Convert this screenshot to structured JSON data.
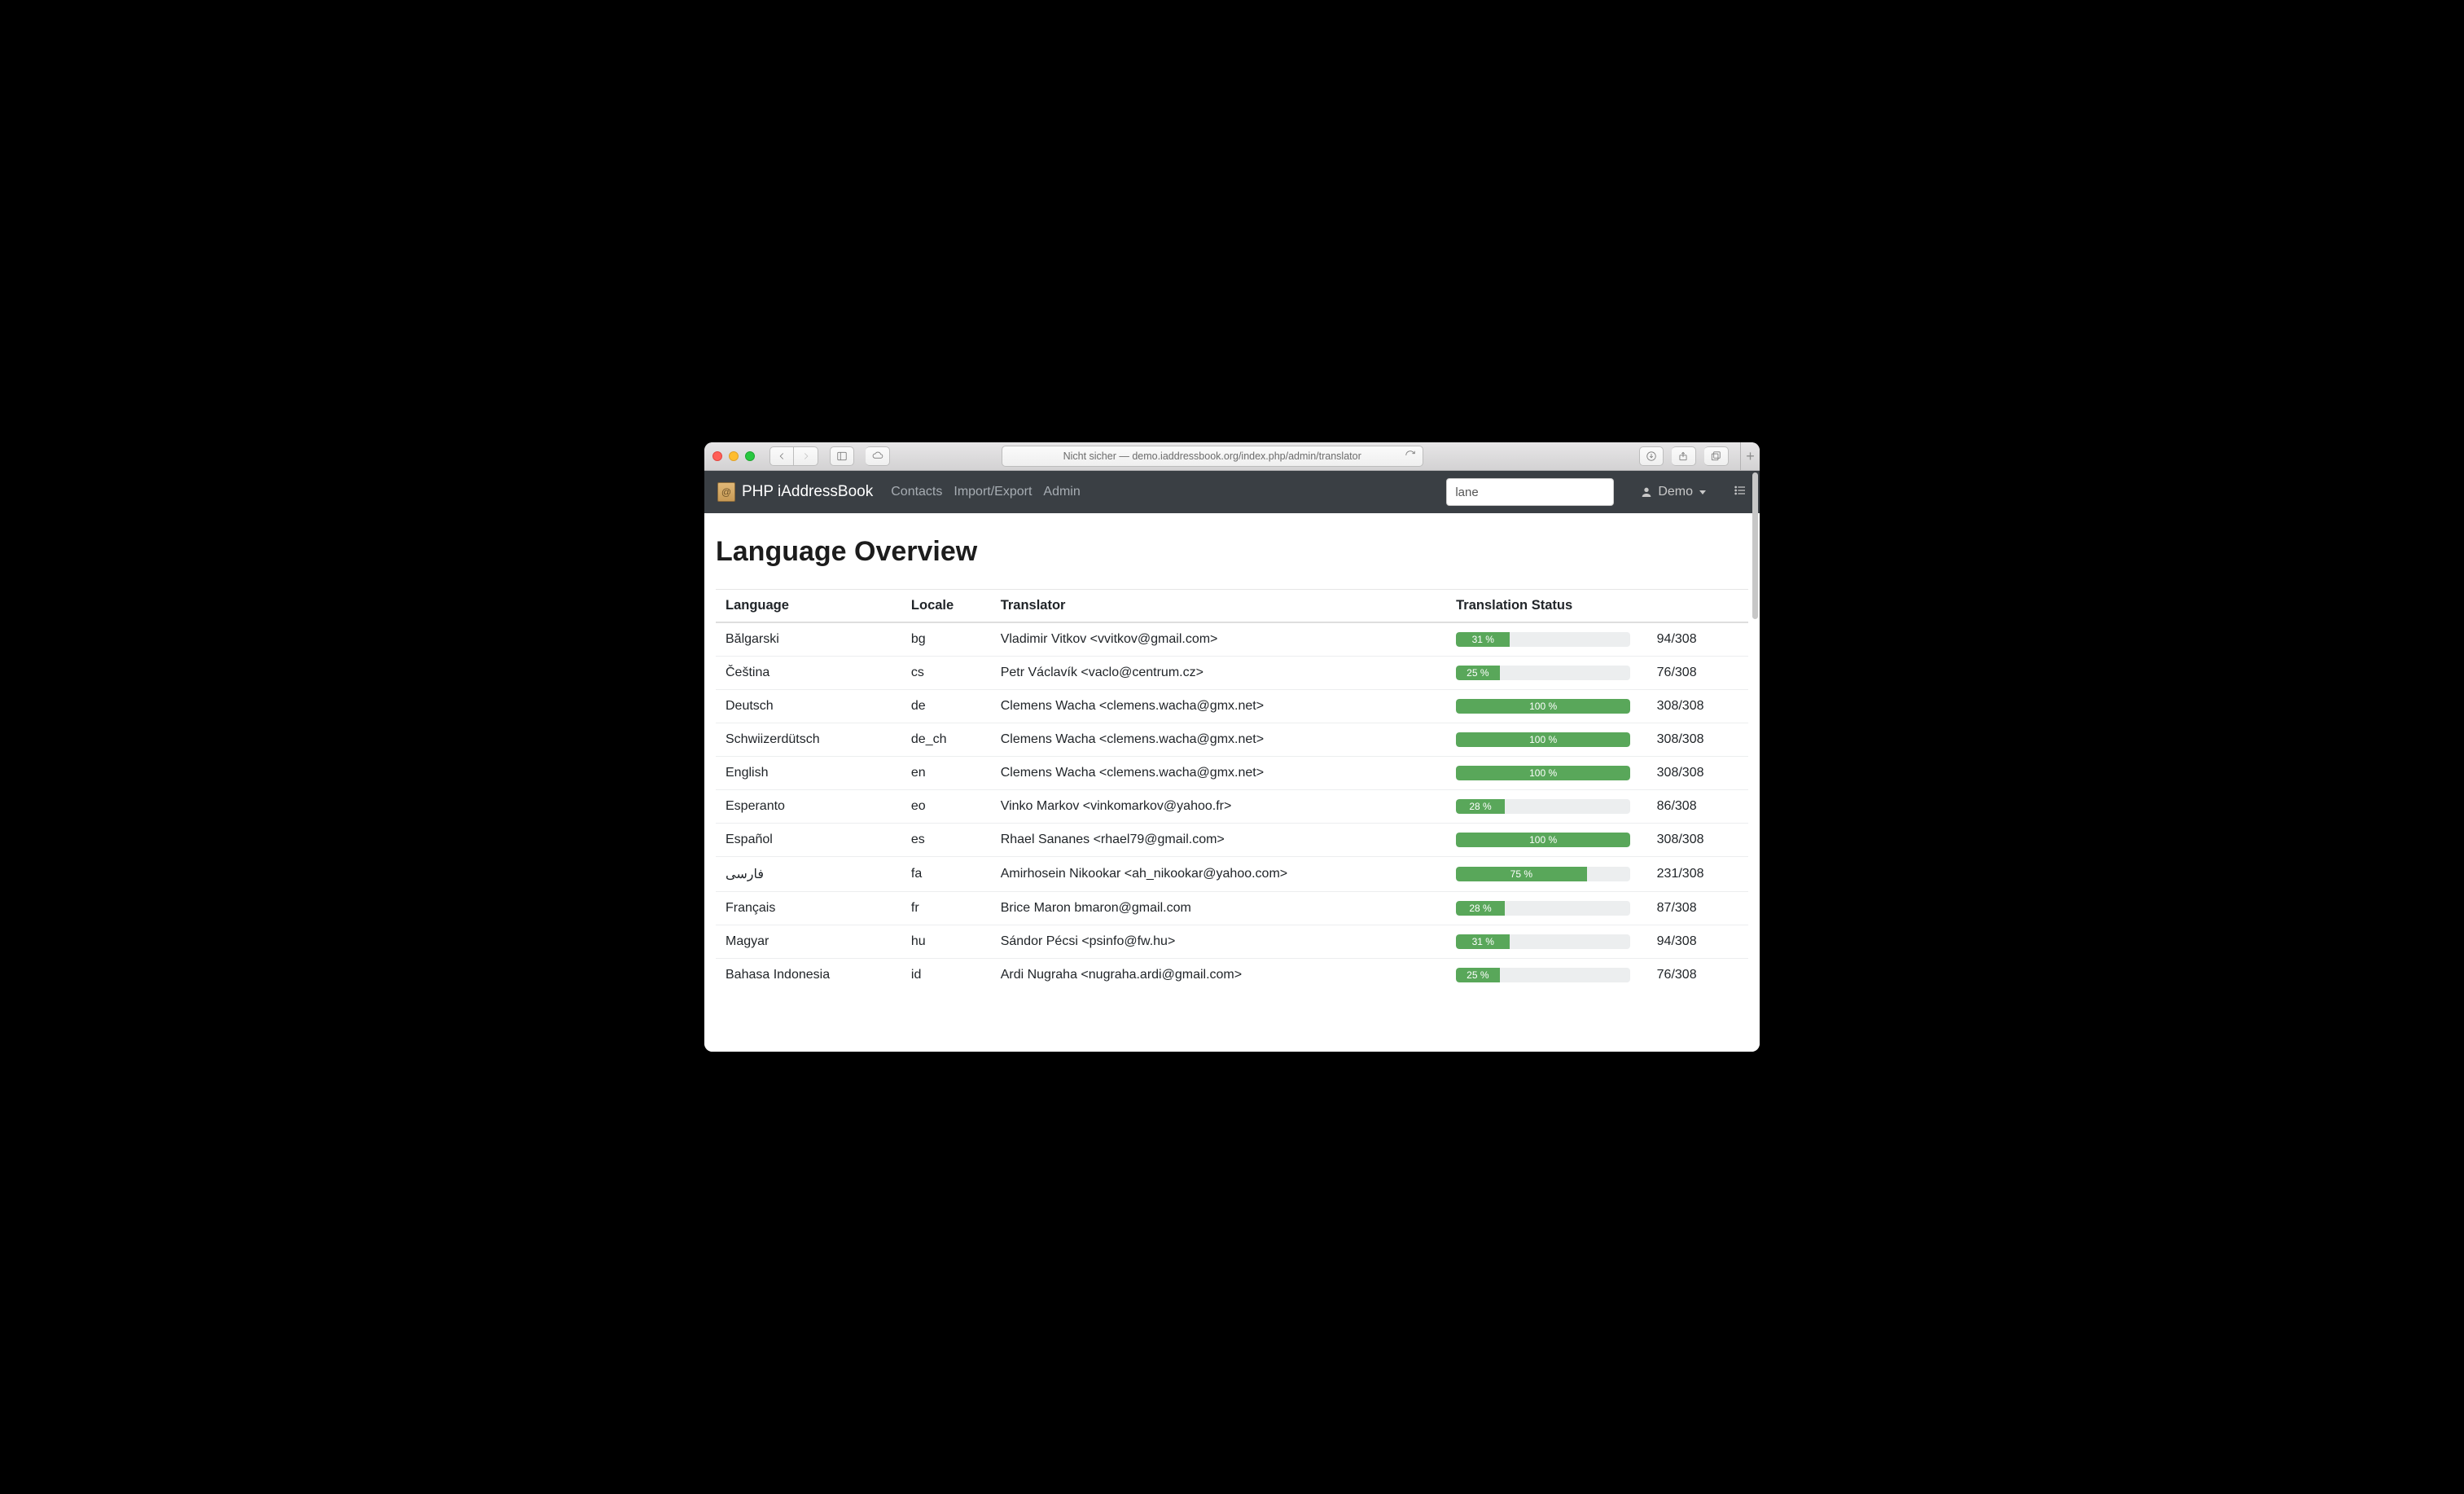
{
  "browser": {
    "url_label": "Nicht sicher — demo.iaddressbook.org/index.php/admin/translator"
  },
  "brand": "PHP iAddressBook",
  "nav": {
    "contacts": "Contacts",
    "import_export": "Import/Export",
    "admin": "Admin"
  },
  "search_value": "lane",
  "user_label": "Demo",
  "page_title": "Language Overview",
  "columns": {
    "language": "Language",
    "locale": "Locale",
    "translator": "Translator",
    "status": "Translation Status"
  },
  "rows": [
    {
      "language": "Bălgarski",
      "locale": "bg",
      "translator": "Vladimir Vitkov <vvitkov@gmail.com>",
      "pct": 31,
      "done": 94,
      "total": 308
    },
    {
      "language": "Čeština",
      "locale": "cs",
      "translator": "Petr Václavík <vaclo@centrum.cz>",
      "pct": 25,
      "done": 76,
      "total": 308
    },
    {
      "language": "Deutsch",
      "locale": "de",
      "translator": "Clemens Wacha <clemens.wacha@gmx.net>",
      "pct": 100,
      "done": 308,
      "total": 308
    },
    {
      "language": "Schwiizerdütsch",
      "locale": "de_ch",
      "translator": "Clemens Wacha <clemens.wacha@gmx.net>",
      "pct": 100,
      "done": 308,
      "total": 308
    },
    {
      "language": "English",
      "locale": "en",
      "translator": "Clemens Wacha <clemens.wacha@gmx.net>",
      "pct": 100,
      "done": 308,
      "total": 308
    },
    {
      "language": "Esperanto",
      "locale": "eo",
      "translator": "Vinko Markov <vinkomarkov@yahoo.fr>",
      "pct": 28,
      "done": 86,
      "total": 308
    },
    {
      "language": "Español",
      "locale": "es",
      "translator": "Rhael Sananes <rhael79@gmail.com>",
      "pct": 100,
      "done": 308,
      "total": 308
    },
    {
      "language": "فارسی",
      "locale": "fa",
      "translator": "Amirhosein Nikookar <ah_nikookar@yahoo.com>",
      "pct": 75,
      "done": 231,
      "total": 308
    },
    {
      "language": "Français",
      "locale": "fr",
      "translator": "Brice Maron bmaron@gmail.com",
      "pct": 28,
      "done": 87,
      "total": 308
    },
    {
      "language": "Magyar",
      "locale": "hu",
      "translator": "Sándor Pécsi <psinfo@fw.hu>",
      "pct": 31,
      "done": 94,
      "total": 308
    },
    {
      "language": "Bahasa Indonesia",
      "locale": "id",
      "translator": "Ardi Nugraha <nugraha.ardi@gmail.com>",
      "pct": 25,
      "done": 76,
      "total": 308
    }
  ]
}
